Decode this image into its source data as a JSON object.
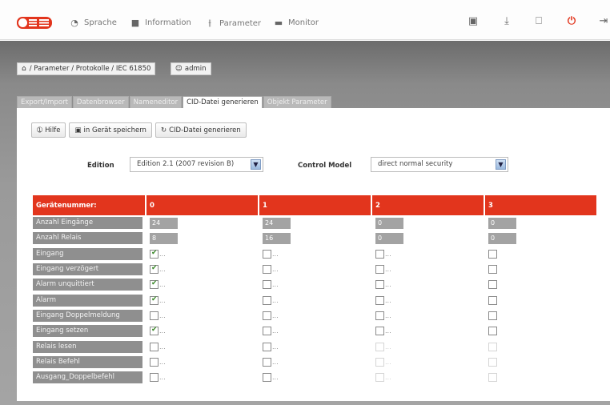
{
  "nav": {
    "sprache": "Sprache",
    "information": "Information",
    "parameter": "Parameter",
    "monitor": "Monitor"
  },
  "breadcrumb": "/ Parameter / Protokolle / IEC 61850",
  "user": "admin",
  "tabs": [
    "Export/Import",
    "Datenbrowser",
    "Nameneditor",
    "CID-Datei generieren",
    "Objekt Parameter"
  ],
  "buttons": {
    "help": "Hilfe",
    "save": "in Gerät speichern",
    "generate": "CID-Datei generieren"
  },
  "edition": {
    "label": "Edition",
    "value": "Edition 2.1 (2007 revision B)"
  },
  "control_model": {
    "label": "Control Model",
    "value": "direct normal security"
  },
  "table": {
    "header_label": "Gerätenummer:",
    "columns": [
      "0",
      "1",
      "2",
      "3"
    ],
    "number_rows": [
      {
        "label": "Anzahl Eingänge",
        "values": [
          "24",
          "24",
          "0",
          "0"
        ]
      },
      {
        "label": "Anzahl Relais",
        "values": [
          "8",
          "16",
          "0",
          "0"
        ]
      }
    ],
    "check_rows": [
      {
        "label": "Eingang",
        "checked": [
          true,
          false,
          false,
          false
        ],
        "dots": [
          true,
          true,
          true,
          false
        ],
        "disabled": [
          false,
          false,
          false,
          false
        ]
      },
      {
        "label": "Eingang verzögert",
        "checked": [
          true,
          false,
          false,
          false
        ],
        "dots": [
          true,
          true,
          true,
          false
        ],
        "disabled": [
          false,
          false,
          false,
          false
        ]
      },
      {
        "label": "Alarm unquittiert",
        "checked": [
          true,
          false,
          false,
          false
        ],
        "dots": [
          true,
          true,
          true,
          false
        ],
        "disabled": [
          false,
          false,
          false,
          false
        ]
      },
      {
        "label": "Alarm",
        "checked": [
          true,
          false,
          false,
          false
        ],
        "dots": [
          true,
          true,
          true,
          false
        ],
        "disabled": [
          false,
          false,
          false,
          false
        ]
      },
      {
        "label": "Eingang Doppelmeldung",
        "checked": [
          false,
          false,
          false,
          false
        ],
        "dots": [
          true,
          true,
          true,
          false
        ],
        "disabled": [
          false,
          false,
          false,
          false
        ]
      },
      {
        "label": "Eingang setzen",
        "checked": [
          true,
          false,
          false,
          false
        ],
        "dots": [
          true,
          true,
          true,
          false
        ],
        "disabled": [
          false,
          false,
          false,
          false
        ]
      },
      {
        "label": "Relais lesen",
        "checked": [
          false,
          false,
          false,
          false
        ],
        "dots": [
          true,
          true,
          true,
          false
        ],
        "disabled": [
          false,
          false,
          true,
          true
        ]
      },
      {
        "label": "Relais Befehl",
        "checked": [
          false,
          false,
          false,
          false
        ],
        "dots": [
          true,
          true,
          true,
          false
        ],
        "disabled": [
          false,
          false,
          true,
          true
        ]
      },
      {
        "label": "Ausgang_Doppelbefehl",
        "checked": [
          false,
          false,
          false,
          false
        ],
        "dots": [
          true,
          true,
          true,
          false
        ],
        "disabled": [
          false,
          false,
          true,
          true
        ]
      }
    ],
    "dots_text": "..."
  },
  "colors": {
    "accent": "#e2351d",
    "label_bg": "#8f8f8f"
  },
  "icons": [
    "globe-icon",
    "info-icon",
    "sliders-icon",
    "monitor-icon",
    "save-icon",
    "download-icon",
    "trash-icon",
    "power-icon",
    "logout-icon",
    "home-icon",
    "user-icon",
    "help-icon",
    "refresh-icon"
  ]
}
